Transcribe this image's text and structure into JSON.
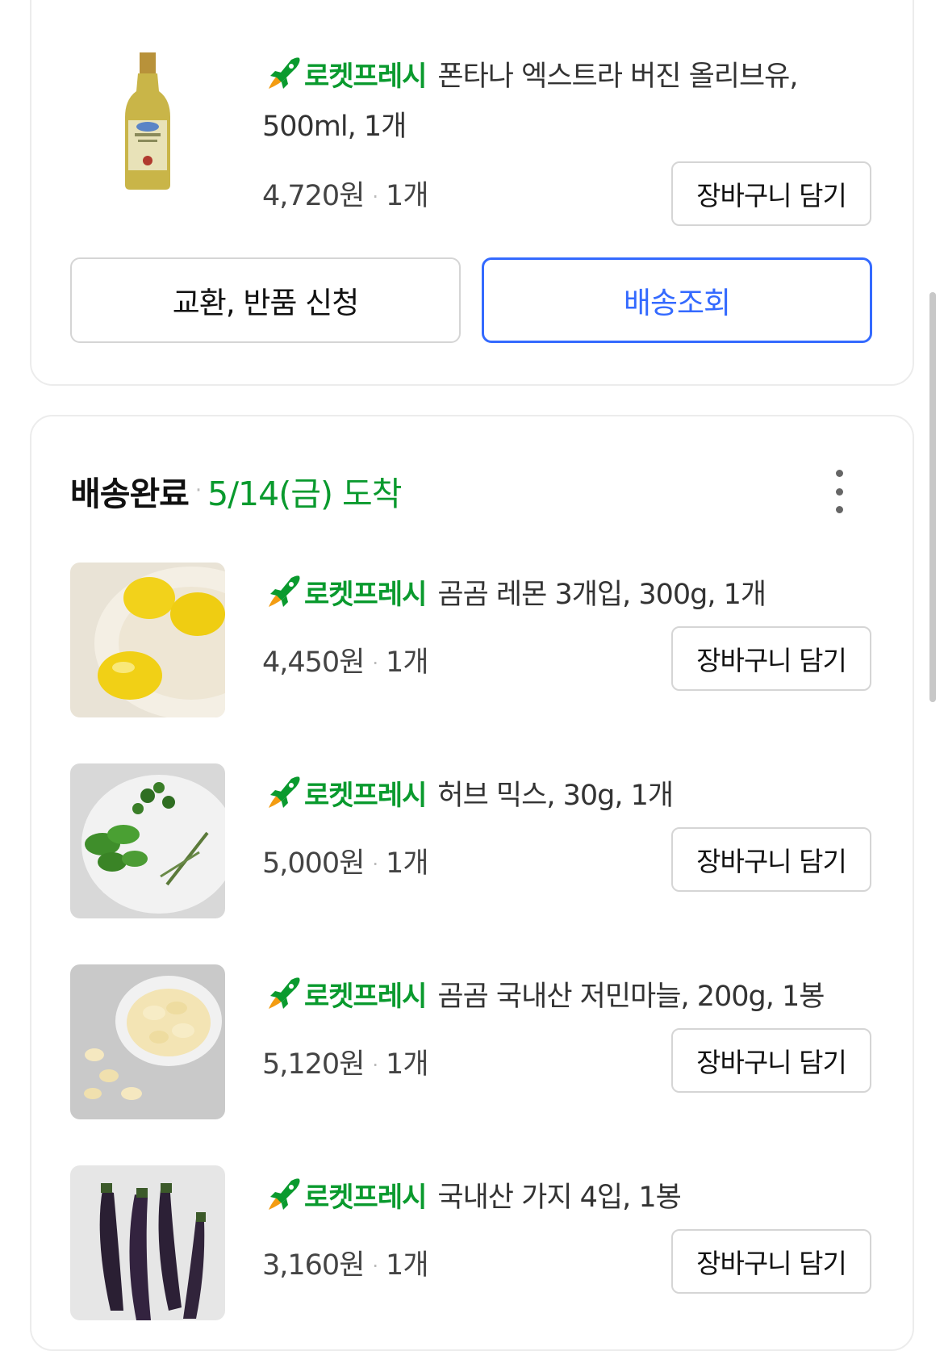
{
  "brand_label": "로켓프레시",
  "prev_order": {
    "item": {
      "title_line1": "폰타나 엑스트라 버진 올리브유,",
      "title_line2": "500ml, 1개",
      "price": "4,720원",
      "qty": "1개",
      "image_icon": "olive-oil-bottle",
      "cart_label": "장바구니 담기"
    },
    "exchange_label": "교환, 반품 신청",
    "track_label": "배송조회"
  },
  "delivered_order": {
    "status": "배송완료",
    "date": "5/14(금) 도착",
    "items": [
      {
        "title": "곰곰 레몬 3개입, 300g, 1개",
        "price": "4,450원",
        "qty": "1개",
        "image_icon": "lemons",
        "cart_label": "장바구니 담기"
      },
      {
        "title": "허브 믹스, 30g, 1개",
        "price": "5,000원",
        "qty": "1개",
        "image_icon": "herbs",
        "cart_label": "장바구니 담기"
      },
      {
        "title": "곰곰 국내산 저민마늘, 200g, 1봉",
        "price": "5,120원",
        "qty": "1개",
        "image_icon": "sliced-garlic",
        "cart_label": "장바구니 담기"
      },
      {
        "title": "국내산 가지 4입, 1봉",
        "price": "3,160원",
        "qty": "1개",
        "image_icon": "eggplants",
        "cart_label": "장바구니 담기"
      }
    ]
  },
  "colors": {
    "brand_green": "#0a9a2e",
    "link_blue": "#346aff",
    "border_gray": "#d5d5d5"
  }
}
